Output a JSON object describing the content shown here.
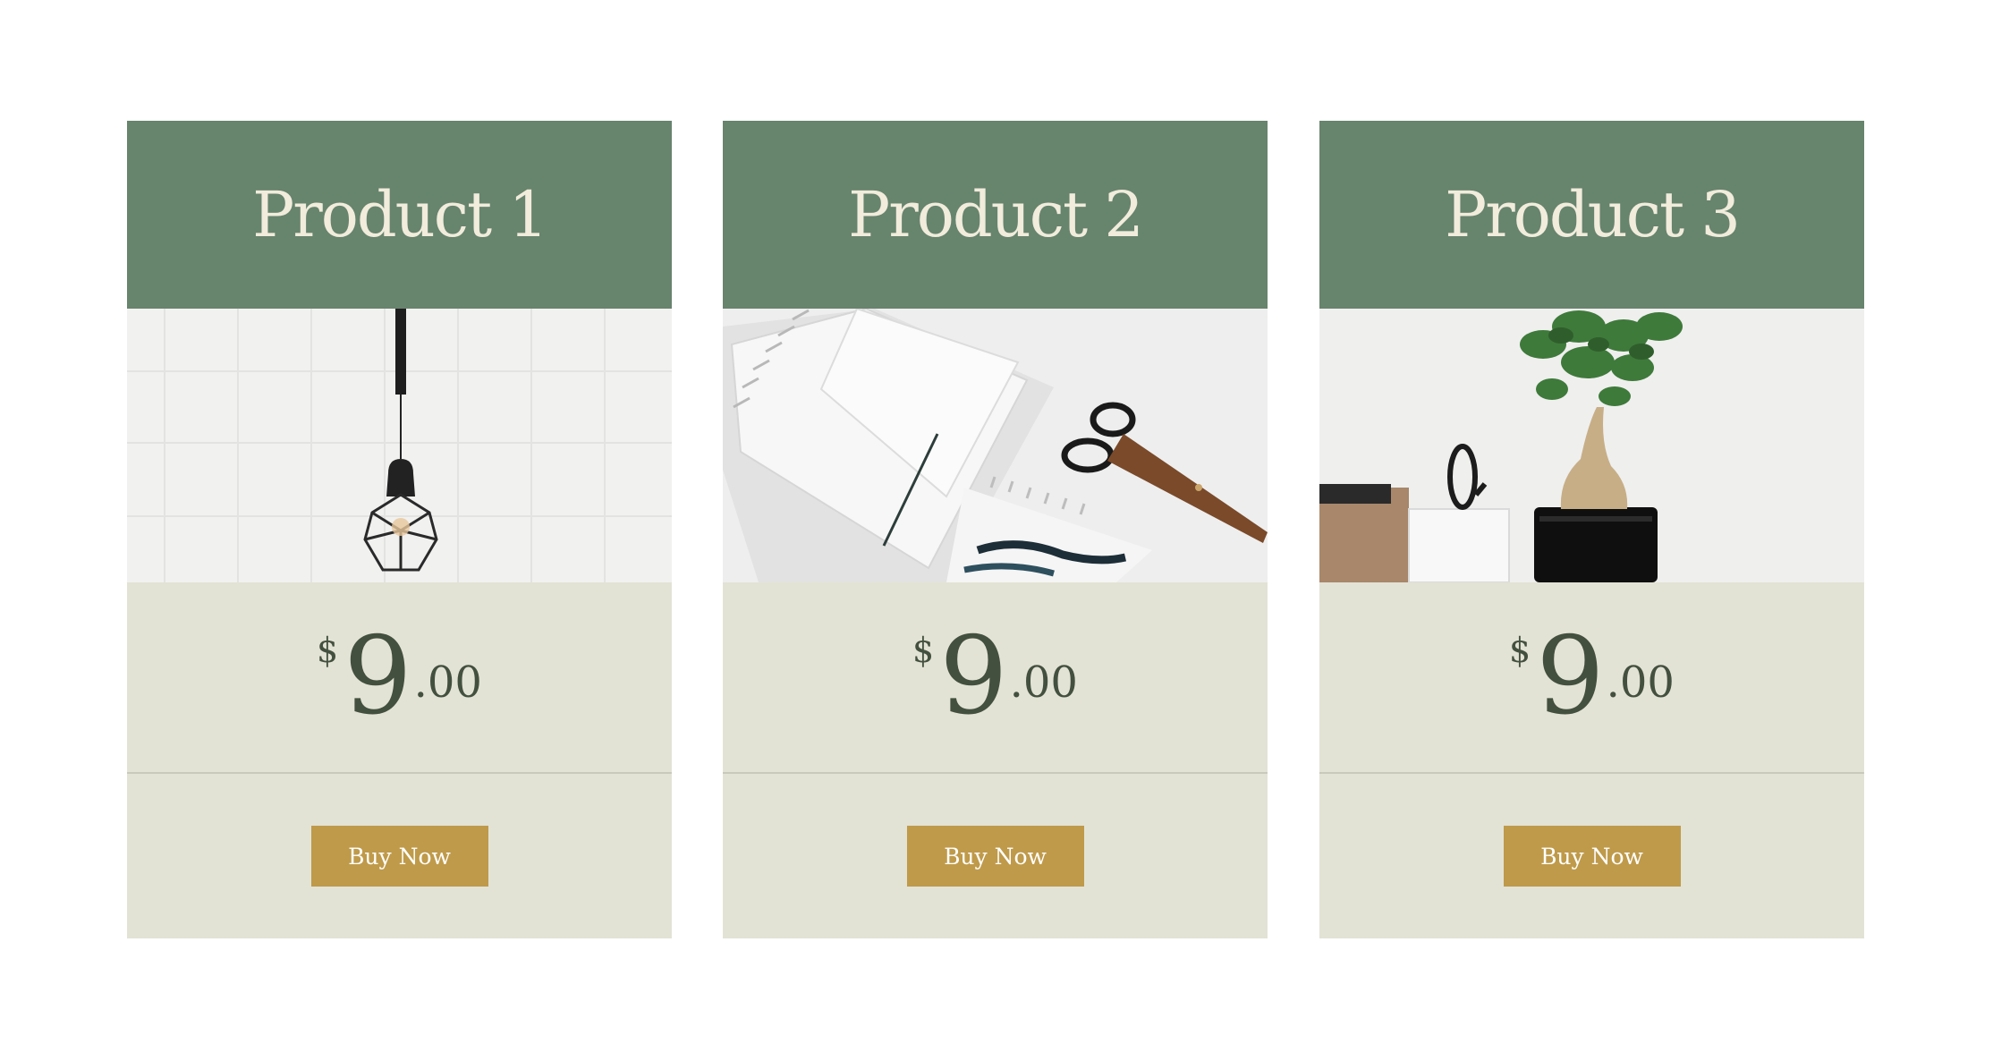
{
  "products": [
    {
      "title": "Product 1",
      "image": "pendant-lamp-photo",
      "price": {
        "currency": "$",
        "integer": "9",
        "decimal": ".00"
      },
      "button_label": "Buy Now"
    },
    {
      "title": "Product 2",
      "image": "notebooks-scissors-photo",
      "price": {
        "currency": "$",
        "integer": "9",
        "decimal": ".00"
      },
      "button_label": "Buy Now"
    },
    {
      "title": "Product 3",
      "image": "bonsai-desk-organizer-photo",
      "price": {
        "currency": "$",
        "integer": "9",
        "decimal": ".00"
      },
      "button_label": "Buy Now"
    }
  ],
  "colors": {
    "header_bg": "#67846d",
    "header_text": "#f1ecdc",
    "card_bg": "#e3e3d5",
    "price_text": "#43503f",
    "button_bg": "#bf9a4a",
    "button_text": "#ffffff"
  }
}
